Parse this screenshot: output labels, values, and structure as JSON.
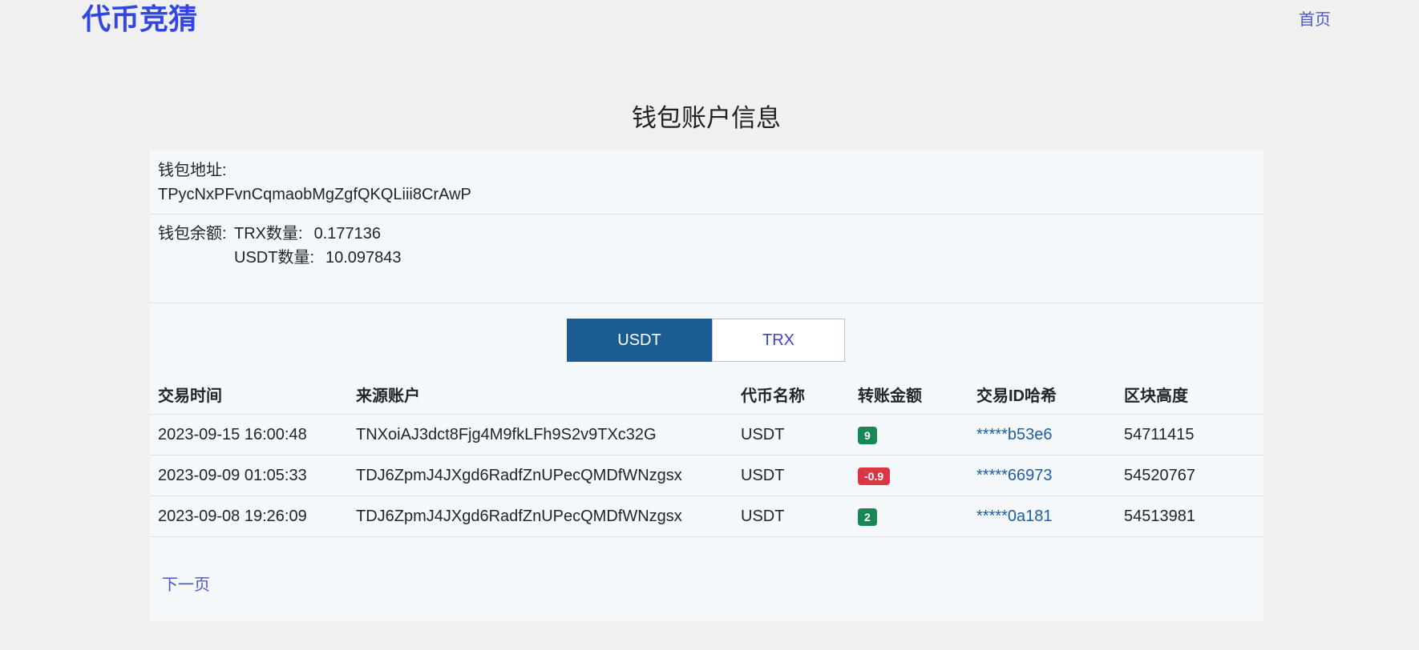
{
  "header": {
    "brand": "代币竞猜",
    "home_link": "首页"
  },
  "page_title": "钱包账户信息",
  "wallet": {
    "address_label": "钱包地址:",
    "address": "TPycNxPFvnCqmaobMgZgfQKQLiii8CrAwP",
    "balance_label": "钱包余额:",
    "trx_label": "TRX数量:",
    "trx_amount": "0.177136",
    "usdt_label": "USDT数量:",
    "usdt_amount": "10.097843"
  },
  "tabs": [
    {
      "label": "USDT",
      "active": true
    },
    {
      "label": "TRX",
      "active": false
    }
  ],
  "table": {
    "columns": [
      "交易时间",
      "来源账户",
      "代币名称",
      "转账金额",
      "交易ID哈希",
      "区块高度"
    ],
    "rows": [
      {
        "time": "2023-09-15 16:00:48",
        "from": "TNXoiAJ3dct8Fjg4M9fkLFh9S2v9TXc32G",
        "token": "USDT",
        "amount": "9",
        "amount_sign": "positive",
        "txid": "*****b53e6",
        "block": "54711415"
      },
      {
        "time": "2023-09-09 01:05:33",
        "from": "TDJ6ZpmJ4JXgd6RadfZnUPecQMDfWNzgsx",
        "token": "USDT",
        "amount": "-0.9",
        "amount_sign": "negative",
        "txid": "*****66973",
        "block": "54520767"
      },
      {
        "time": "2023-09-08 19:26:09",
        "from": "TDJ6ZpmJ4JXgd6RadfZnUPecQMDfWNzgsx",
        "token": "USDT",
        "amount": "2",
        "amount_sign": "positive",
        "txid": "*****0a181",
        "block": "54513981"
      }
    ]
  },
  "pagination": {
    "next_label": "下一页"
  },
  "colors": {
    "brand": "#3347e0",
    "link": "#4c55c9",
    "tab_active_bg": "#1b5c93",
    "badge_positive": "#198754",
    "badge_negative": "#dc3545",
    "txid_link": "#1d5fa5",
    "panel_bg": "#f5f8fa",
    "page_bg": "#f0f0f0"
  }
}
